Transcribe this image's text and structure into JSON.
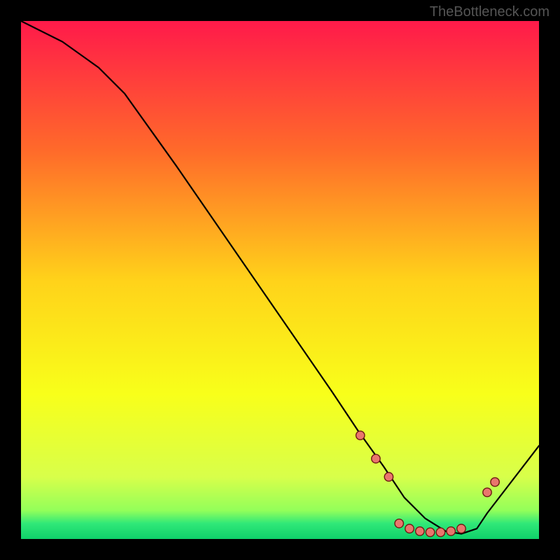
{
  "watermark": "TheBottleneck.com",
  "chart_data": {
    "type": "line",
    "title": "",
    "xlabel": "",
    "ylabel": "",
    "xlim": [
      0,
      100
    ],
    "ylim": [
      0,
      100
    ],
    "series": [
      {
        "name": "curve",
        "x": [
          0,
          8,
          15,
          20,
          30,
          40,
          50,
          60,
          65,
          70,
          74,
          78,
          82,
          85,
          88,
          90,
          100
        ],
        "y": [
          100,
          96,
          91,
          86,
          72,
          57.5,
          43,
          28.5,
          21,
          14,
          8,
          4,
          1.5,
          1,
          2,
          5,
          18
        ]
      }
    ],
    "markers": {
      "name": "points",
      "x": [
        65.5,
        68.5,
        71,
        73,
        75,
        77,
        79,
        81,
        83,
        85,
        90,
        91.5
      ],
      "y": [
        20,
        15.5,
        12,
        3,
        2,
        1.5,
        1.3,
        1.3,
        1.5,
        2,
        9,
        11
      ]
    },
    "background_gradient": {
      "stops": [
        {
          "offset": 0,
          "color": "#ff1a4a"
        },
        {
          "offset": 0.25,
          "color": "#ff6a2a"
        },
        {
          "offset": 0.5,
          "color": "#ffd21a"
        },
        {
          "offset": 0.72,
          "color": "#f8ff1a"
        },
        {
          "offset": 0.88,
          "color": "#d8ff4a"
        },
        {
          "offset": 0.945,
          "color": "#93ff5a"
        },
        {
          "offset": 0.97,
          "color": "#30e878"
        },
        {
          "offset": 1.0,
          "color": "#0fd26a"
        }
      ]
    },
    "marker_style": {
      "fill": "#e9766d",
      "stroke": "#6d1a12",
      "radius": 6.2
    }
  }
}
